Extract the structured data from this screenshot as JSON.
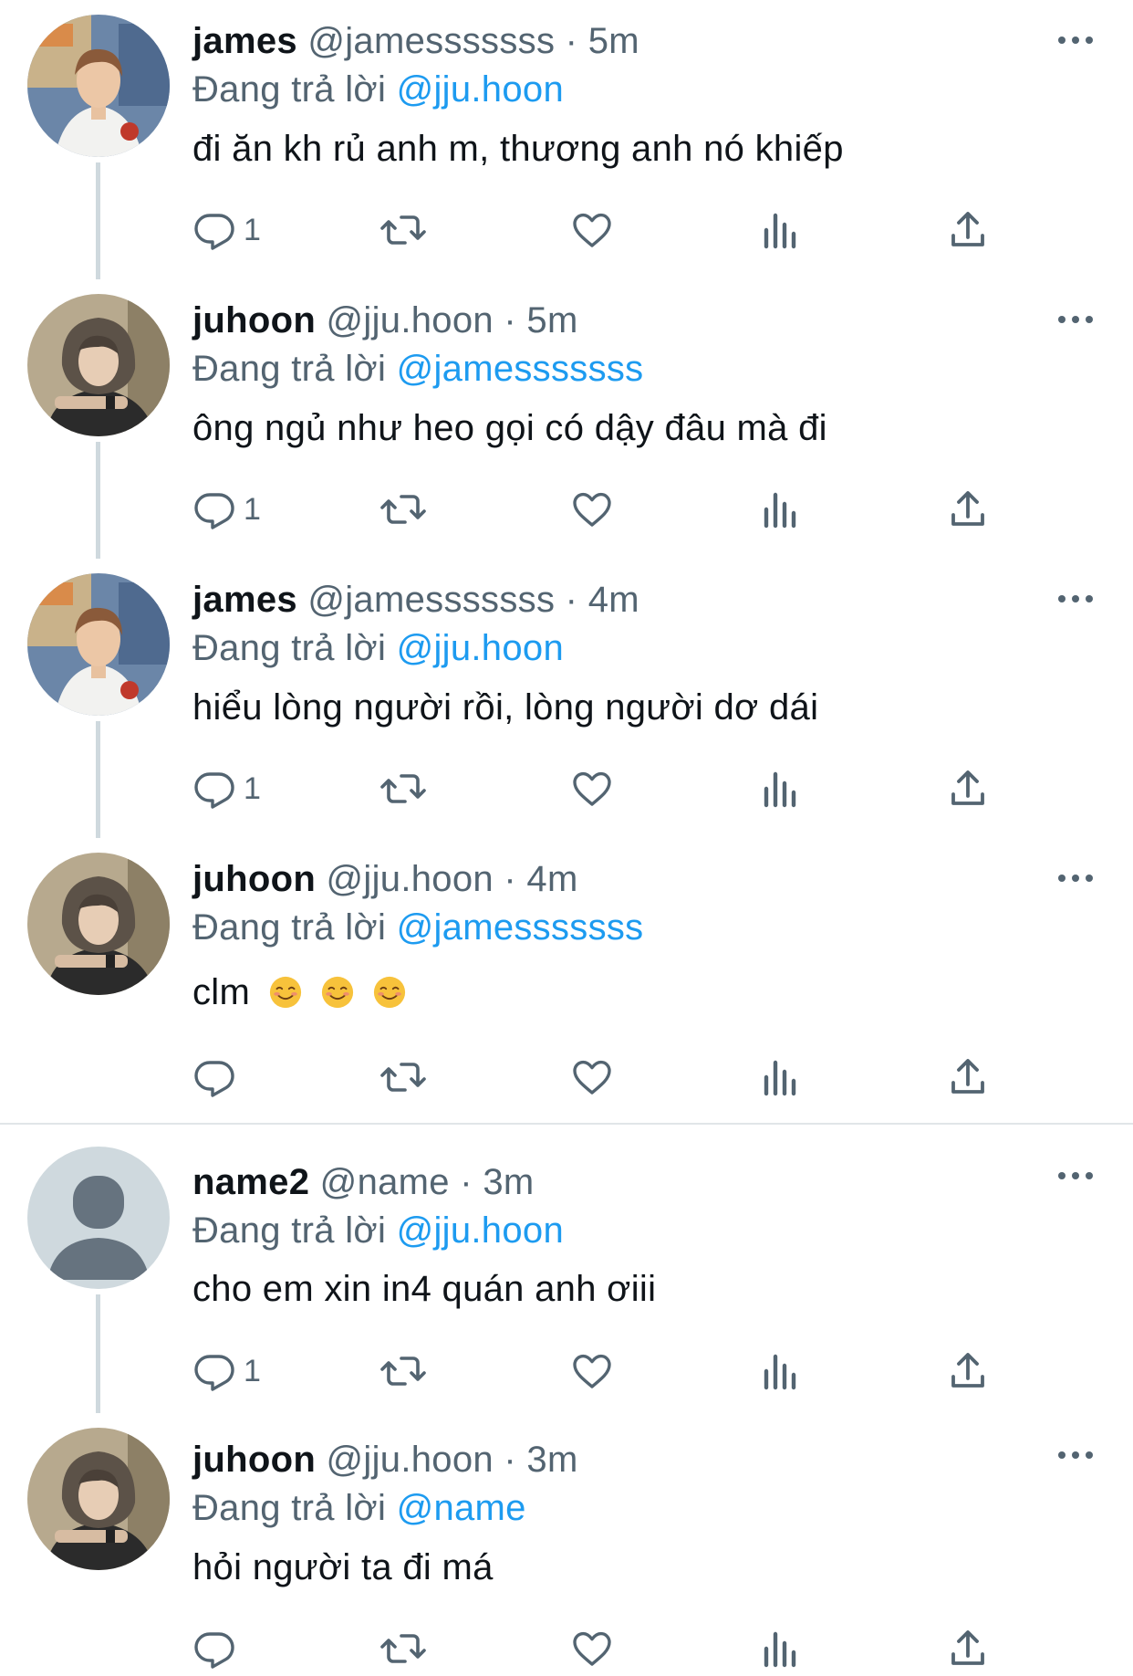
{
  "reply_prefix": "Đang trả lời",
  "tweets": [
    {
      "name": "james",
      "handle": "@jamesssssss",
      "separator": "·",
      "time": "5m",
      "reply_to": "@jju.hoon",
      "text": "đi ăn kh rủ anh m, thương anh nó khiếp",
      "reply_count": "1",
      "avatar": "james-photo"
    },
    {
      "name": "juhoon",
      "handle": "@jju.hoon",
      "separator": "·",
      "time": "5m",
      "reply_to": "@jamesssssss",
      "text": "ông ngủ như heo gọi có dậy đâu mà đi",
      "reply_count": "1",
      "avatar": "juhoon-photo"
    },
    {
      "name": "james",
      "handle": "@jamesssssss",
      "separator": "·",
      "time": "4m",
      "reply_to": "@jju.hoon",
      "text": "hiểu lòng người rồi, lòng người dơ dái",
      "reply_count": "1",
      "avatar": "james-photo"
    },
    {
      "name": "juhoon",
      "handle": "@jju.hoon",
      "separator": "·",
      "time": "4m",
      "reply_to": "@jamesssssss",
      "text": "clm",
      "emojis": [
        "smiling-face",
        "smiling-face",
        "smiling-face"
      ],
      "reply_count": "",
      "avatar": "juhoon-photo"
    },
    {
      "name": "name2",
      "handle": "@name",
      "separator": "·",
      "time": "3m",
      "reply_to": "@jju.hoon",
      "text": "cho em xin in4 quán anh ơiii",
      "reply_count": "1",
      "avatar": "default-avatar"
    },
    {
      "name": "juhoon",
      "handle": "@jju.hoon",
      "separator": "·",
      "time": "3m",
      "reply_to": "@name",
      "text": "hỏi người ta đi má",
      "reply_count": "",
      "avatar": "juhoon-photo"
    }
  ],
  "icons": {
    "reply": "reply-icon",
    "retweet": "retweet-icon",
    "like": "like-icon",
    "views": "views-icon",
    "share": "share-icon",
    "more": "more-icon"
  },
  "colors": {
    "mention": "#1d9bf0",
    "secondary_text": "#536471",
    "thread_line": "#cfd9de"
  }
}
